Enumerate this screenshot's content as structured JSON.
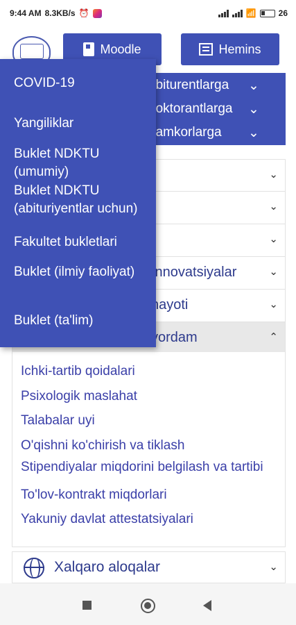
{
  "statusbar": {
    "time": "9:44 AM",
    "speed": "8.3KB/s",
    "battery": "26"
  },
  "topbar": {
    "moodle_label": "Moodle",
    "hemis_label": "Hemins"
  },
  "band": {
    "items": [
      {
        "label": "abiturentlarga",
        "chevron": "⌄"
      },
      {
        "label": "doktorantlarga",
        "chevron": "⌄"
      },
      {
        "label": "hamkorlarga",
        "chevron": "⌄"
      }
    ]
  },
  "accordion": {
    "rows": [
      {
        "label": "",
        "chevron": "⌄"
      },
      {
        "label": "",
        "chevron": "⌄"
      },
      {
        "label": "",
        "chevron": "⌄"
      },
      {
        "label": "Innovatsiyalar",
        "chevron": "⌄"
      },
      {
        "label": "hayoti",
        "chevron": "⌄"
      },
      {
        "label": "yordam",
        "chevron": "⌃"
      }
    ]
  },
  "submenu": {
    "links": [
      "Ichki-tartib qoidalari",
      "Psixologik maslahat",
      "Talabalar uyi",
      "O'qishni ko'chirish va tiklash",
      "Stipendiyalar miqdorini belgilash va tartibi",
      "To'lov-kontrakt miqdorlari",
      "Yakuniy davlat attestatsiyalari"
    ]
  },
  "intl": {
    "label": "Xalqaro aloqalar",
    "chevron": "⌄"
  },
  "dropdown": {
    "items": [
      "COVID-19",
      "Yangiliklar",
      "Buklet NDKTU (umumiy)",
      "Buklet NDKTU (abituriyentlar uchun)",
      "Fakultet bukletlari",
      "Buklet (ilmiy faoliyat)",
      "Buklet (ta'lim)"
    ]
  },
  "colors": {
    "primary": "#3f51b5",
    "link": "#3a3fa8",
    "heading": "#2d3a8c"
  }
}
